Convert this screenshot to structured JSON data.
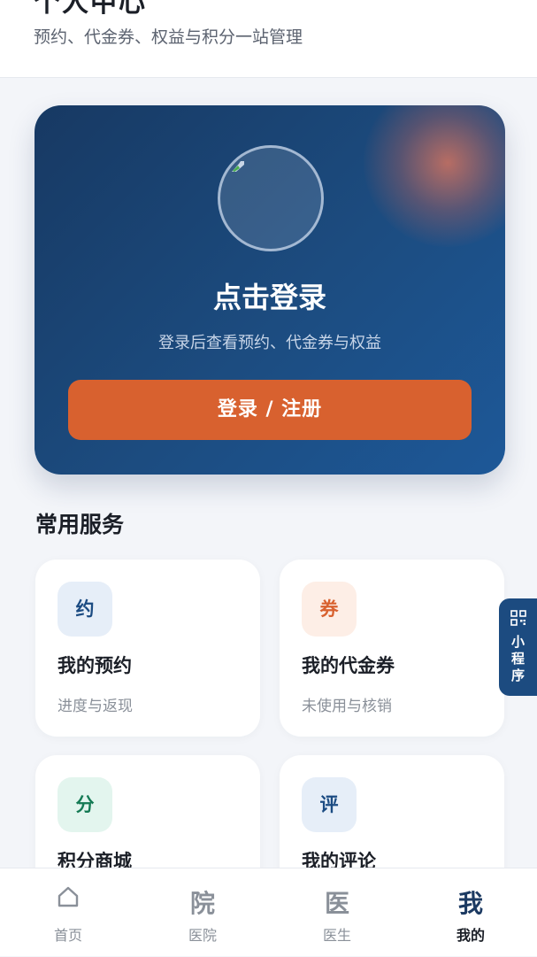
{
  "header": {
    "title": "个人中心",
    "subtitle": "预约、代金券、权益与积分一站管理"
  },
  "hero": {
    "title": "点击登录",
    "subtitle": "登录后查看预约、代金券与权益",
    "button_label": "登录 / 注册"
  },
  "services": {
    "title": "常用服务",
    "items": [
      {
        "icon": "约",
        "title": "我的预约",
        "subtitle": "进度与返现"
      },
      {
        "icon": "券",
        "title": "我的代金券",
        "subtitle": "未使用与核销"
      },
      {
        "icon": "分",
        "title": "积分商城",
        "subtitle": ""
      },
      {
        "icon": "评",
        "title": "我的评论",
        "subtitle": ""
      }
    ]
  },
  "mini_program": {
    "label": "小程序"
  },
  "tabbar": {
    "items": [
      {
        "icon": "⌂",
        "label": "首页"
      },
      {
        "icon": "院",
        "label": "医院"
      },
      {
        "icon": "医",
        "label": "医生"
      },
      {
        "icon": "我",
        "label": "我的"
      }
    ],
    "active": "我的"
  },
  "colors": {
    "hero_bg": "#1c4c80",
    "accent": "#d8612f",
    "active_tab": "#1c3a62"
  }
}
